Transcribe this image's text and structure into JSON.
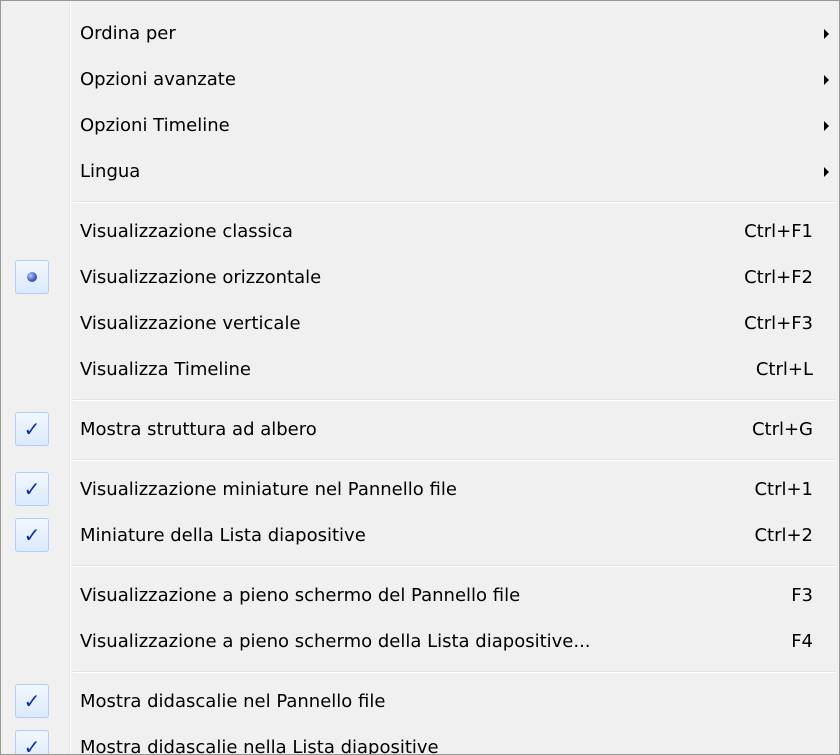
{
  "menu": {
    "items": [
      {
        "type": "item",
        "label": "Ordina per",
        "shortcut": "",
        "submenu": true,
        "mark": "none"
      },
      {
        "type": "item",
        "label": "Opzioni avanzate",
        "shortcut": "",
        "submenu": true,
        "mark": "none"
      },
      {
        "type": "item",
        "label": "Opzioni Timeline",
        "shortcut": "",
        "submenu": true,
        "mark": "none"
      },
      {
        "type": "item",
        "label": "Lingua",
        "shortcut": "",
        "submenu": true,
        "mark": "none"
      },
      {
        "type": "separator"
      },
      {
        "type": "item",
        "label": "Visualizzazione classica",
        "shortcut": "Ctrl+F1",
        "submenu": false,
        "mark": "none"
      },
      {
        "type": "item",
        "label": "Visualizzazione orizzontale",
        "shortcut": "Ctrl+F2",
        "submenu": false,
        "mark": "radio"
      },
      {
        "type": "item",
        "label": "Visualizzazione verticale",
        "shortcut": "Ctrl+F3",
        "submenu": false,
        "mark": "none"
      },
      {
        "type": "item",
        "label": "Visualizza Timeline",
        "shortcut": "Ctrl+L",
        "submenu": false,
        "mark": "none"
      },
      {
        "type": "separator"
      },
      {
        "type": "item",
        "label": "Mostra struttura ad albero",
        "shortcut": "Ctrl+G",
        "submenu": false,
        "mark": "check"
      },
      {
        "type": "separator"
      },
      {
        "type": "item",
        "label": "Visualizzazione miniature nel Pannello file",
        "shortcut": "Ctrl+1",
        "submenu": false,
        "mark": "check"
      },
      {
        "type": "item",
        "label": "Miniature della Lista diapositive",
        "shortcut": "Ctrl+2",
        "submenu": false,
        "mark": "check"
      },
      {
        "type": "separator"
      },
      {
        "type": "item",
        "label": "Visualizzazione a pieno schermo del Pannello file",
        "shortcut": "F3",
        "submenu": false,
        "mark": "none"
      },
      {
        "type": "item",
        "label": "Visualizzazione a pieno schermo della Lista diapositive...",
        "shortcut": "F4",
        "submenu": false,
        "mark": "none"
      },
      {
        "type": "separator"
      },
      {
        "type": "item",
        "label": "Mostra didascalie nel Pannello file",
        "shortcut": "",
        "submenu": false,
        "mark": "check"
      },
      {
        "type": "item",
        "label": "Mostra didascalie nella Lista diapositive",
        "shortcut": "",
        "submenu": false,
        "mark": "check"
      }
    ],
    "check_glyph": "✓",
    "colors": {
      "background": "#f0f0f0",
      "border": "#979797",
      "check_color": "#0c2fa8",
      "mark_box_border": "#aecff7",
      "separator": "#e2e3e3"
    }
  }
}
